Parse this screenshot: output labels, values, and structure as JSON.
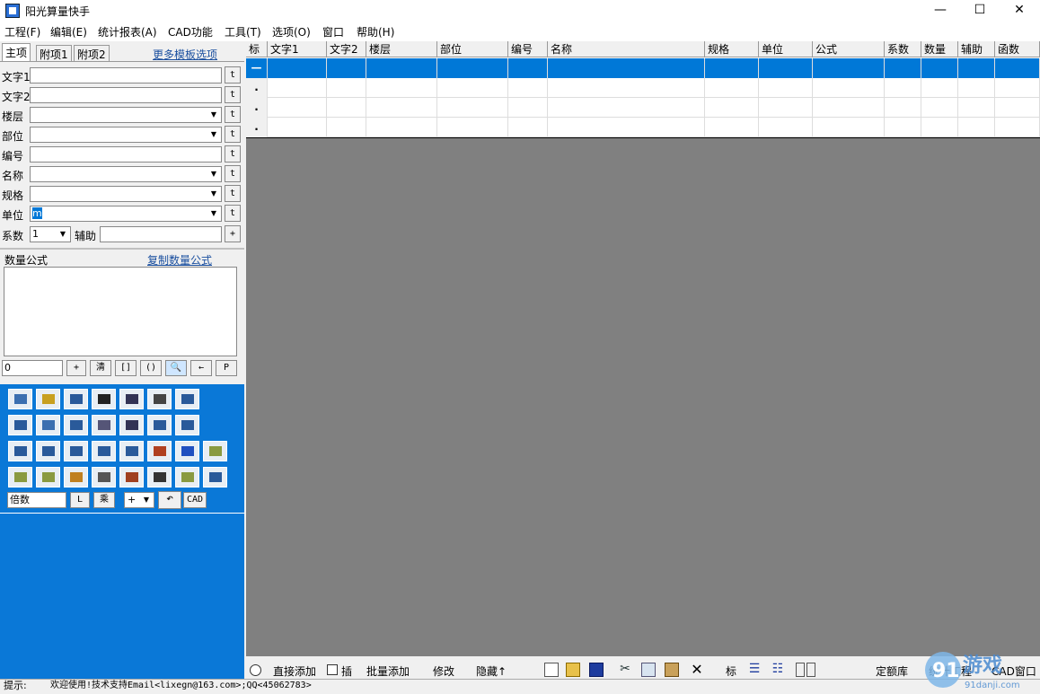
{
  "window": {
    "title": "阳光算量快手",
    "minimize": "—",
    "maximize": "☐",
    "close": "✕"
  },
  "menu": [
    "工程(F)",
    "编辑(E)",
    "统计报表(A)",
    "CAD功能",
    "工具(T)",
    "选项(O)",
    "窗口",
    "帮助(H)"
  ],
  "tabs": [
    "主项",
    "附项1",
    "附项2"
  ],
  "more_templates": "更多模板选项",
  "fields": [
    {
      "label": "文字1",
      "value": "",
      "dropdown": false
    },
    {
      "label": "文字2",
      "value": "",
      "dropdown": false
    },
    {
      "label": "楼层",
      "value": "",
      "dropdown": true
    },
    {
      "label": "部位",
      "value": "",
      "dropdown": true
    },
    {
      "label": "编号",
      "value": "",
      "dropdown": false
    },
    {
      "label": "名称",
      "value": "",
      "dropdown": true
    },
    {
      "label": "规格",
      "value": "",
      "dropdown": true
    },
    {
      "label": "单位",
      "value": "m",
      "dropdown": true
    }
  ],
  "t_button": "t",
  "coef": {
    "label": "系数",
    "value": "1",
    "aux_label": "辅助",
    "plus": "+"
  },
  "formula": {
    "label": "数量公式",
    "copy_link": "复制数量公式",
    "result": "0"
  },
  "formula_buttons": [
    "+",
    "清",
    "[]",
    "()",
    "🔍",
    "←",
    "P"
  ],
  "multiplier": {
    "value": "倍数",
    "l_btn": "L",
    "mul_btn": "乘",
    "op": "+",
    "cad_btn": "CAD"
  },
  "grid": {
    "headers": [
      "标",
      "文字1",
      "文字2",
      "楼层",
      "部位",
      "编号",
      "名称",
      "规格",
      "单位",
      "公式",
      "系数",
      "数量",
      "辅助",
      "函数"
    ],
    "rows": [
      {
        "marker": "—"
      },
      {
        "marker": "."
      },
      {
        "marker": "."
      },
      {
        "marker": "."
      }
    ]
  },
  "bottom": {
    "direct_add": "直接添加",
    "insert": "插",
    "batch_add": "批量添加",
    "modify": "修改",
    "hide": "隐藏↑",
    "mark": "标",
    "quota": "定额库",
    "stats": "统计工程",
    "cad_window": "CAD窗口"
  },
  "status": {
    "label": "提示:",
    "message": "欢迎使用!技术支持Email<lixegn@163.com>;QQ<45062783>"
  },
  "watermark": {
    "brand": "游戏",
    "site": "91danji.com"
  }
}
